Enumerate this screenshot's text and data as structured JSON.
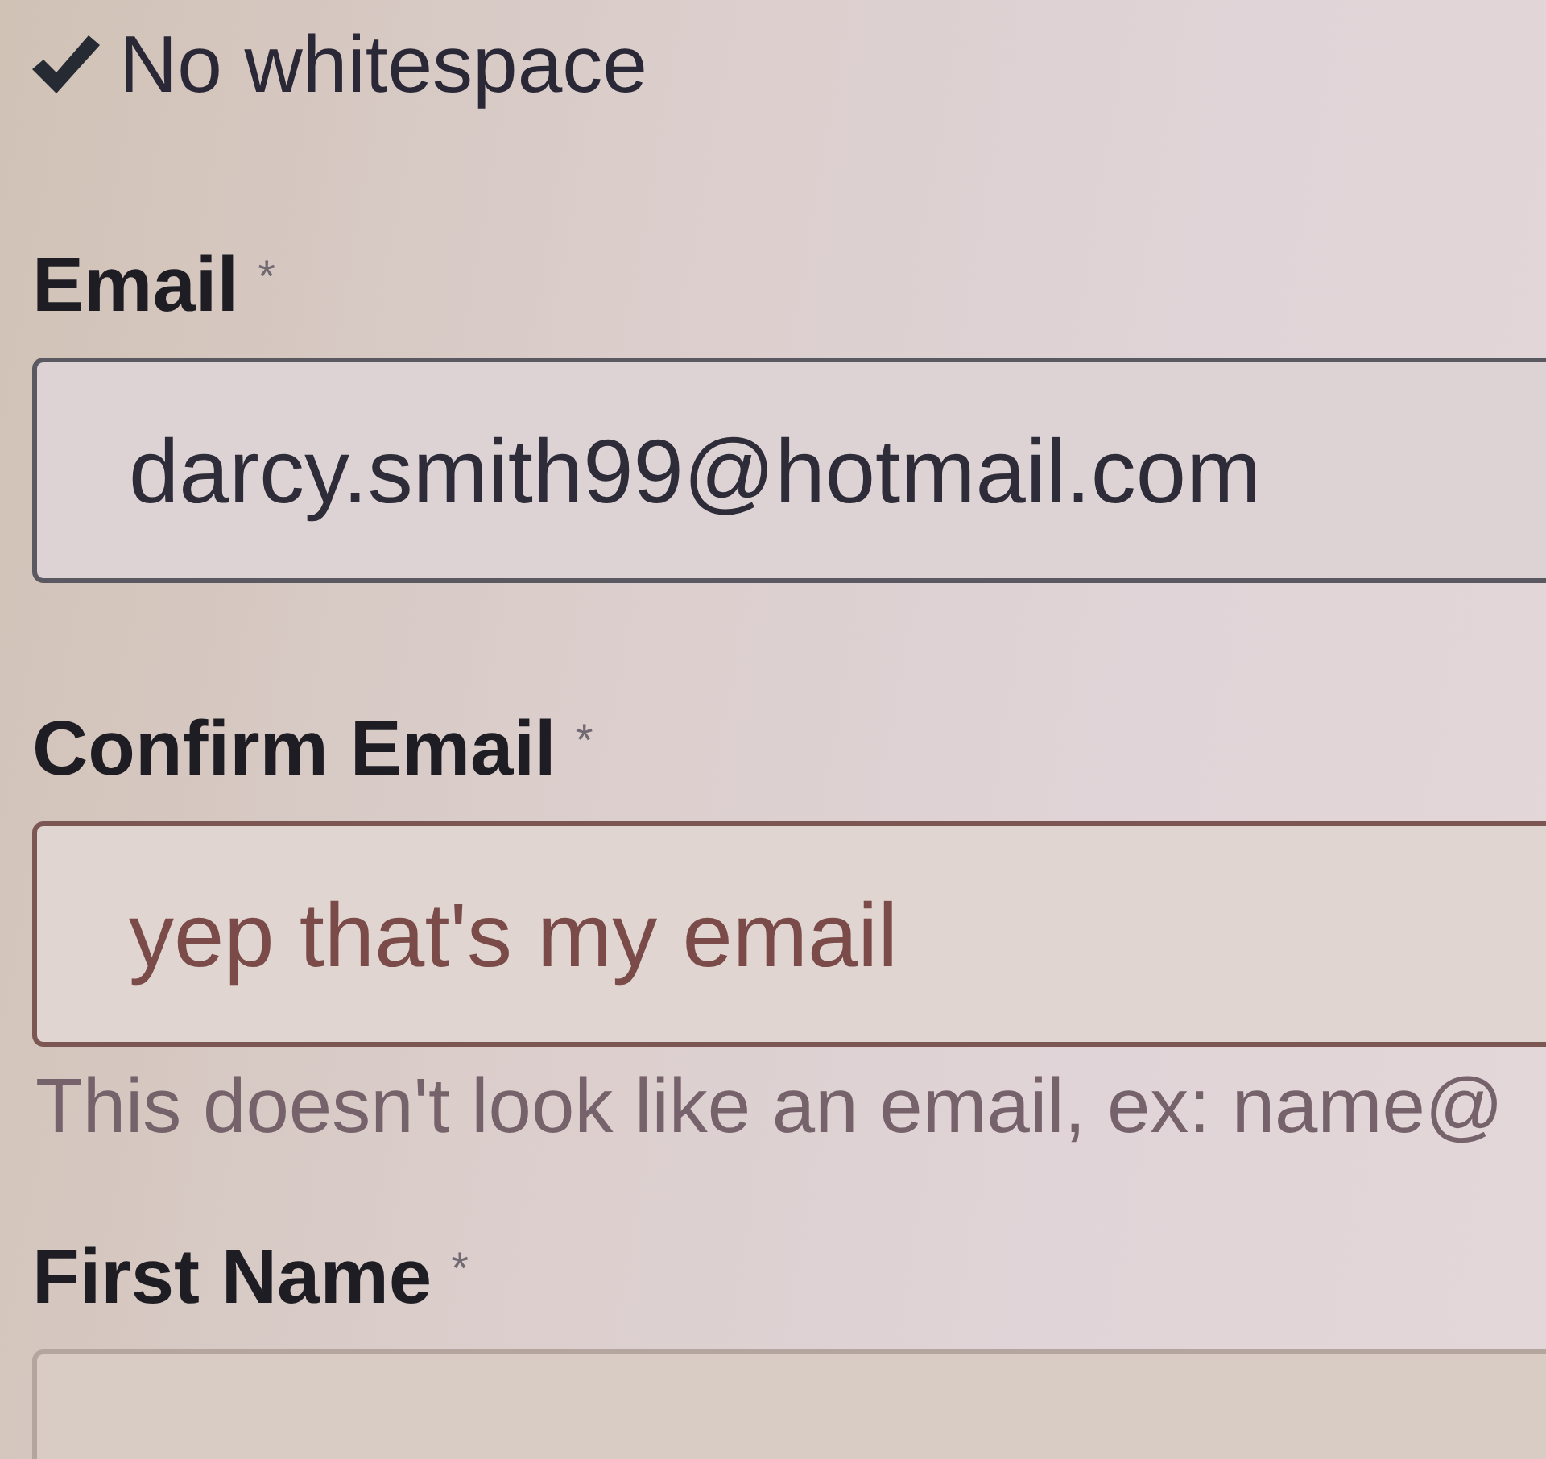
{
  "rules": [
    {
      "label": "No whitespace",
      "met": true
    }
  ],
  "fields": [
    {
      "label": "Email",
      "required_mark": "*",
      "value": "darcy.smith99@hotmail.com",
      "invalid": false
    },
    {
      "label": "Confirm Email",
      "required_mark": "*",
      "value": "yep that's my email",
      "invalid": true,
      "error": "This doesn't look like an email, ex: name@"
    },
    {
      "label": "First Name",
      "required_mark": "*",
      "invalid": false
    }
  ]
}
